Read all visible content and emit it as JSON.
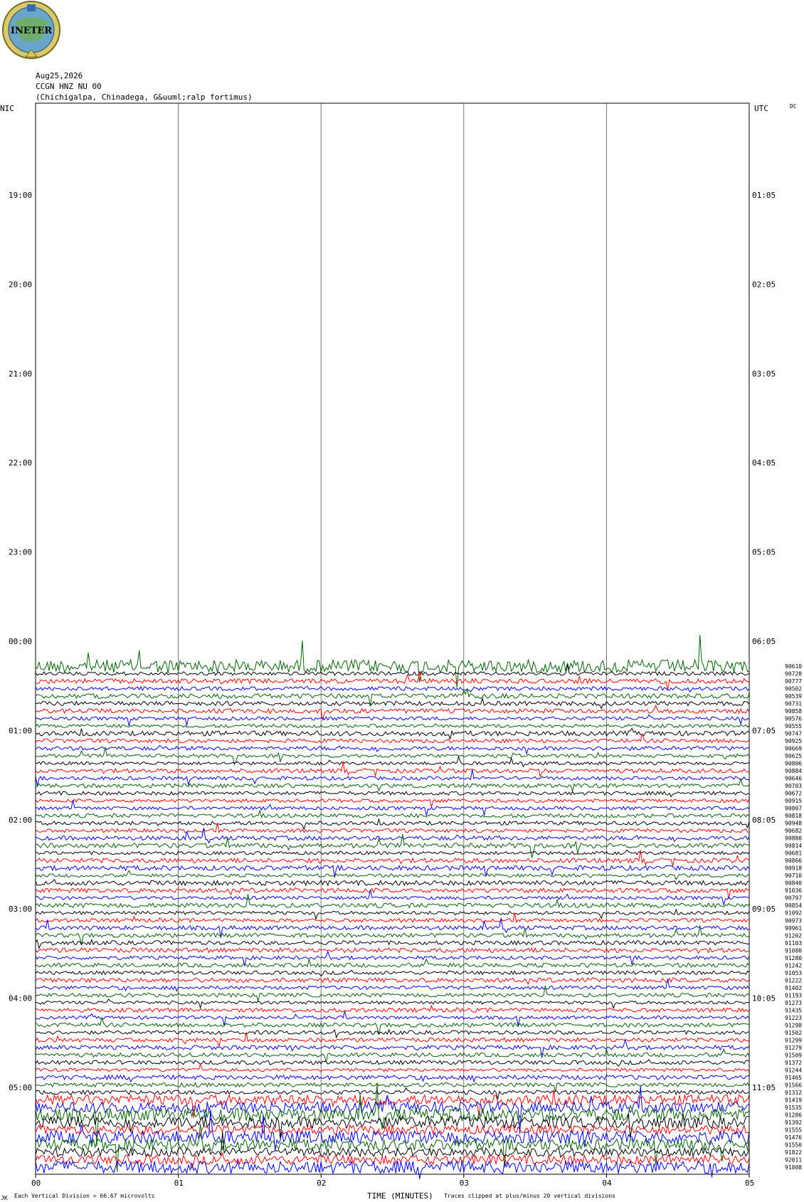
{
  "header": {
    "logo_text": "INETER",
    "date": "Aug25,2026",
    "station": "CCGN HNZ NU 00",
    "location": "(Chichigalpa, Chinadega, G&uuml;ralp fortimus)"
  },
  "chart_data": {
    "type": "line",
    "left_axis_label": "NIC",
    "right_axis_label": "UTC",
    "dc_label": "DC",
    "left_hour_labels": [
      "19:00",
      "20:00",
      "21:00",
      "22:00",
      "23:00",
      "00:00",
      "01:00",
      "02:00",
      "03:00",
      "04:00",
      "05:00"
    ],
    "right_hour_labels": [
      "01:05",
      "02:05",
      "03:05",
      "04:05",
      "05:05",
      "06:05",
      "07:05",
      "08:05",
      "09:05",
      "10:05",
      "11:05"
    ],
    "x_tick_labels": [
      "00",
      "01",
      "02",
      "03",
      "04",
      "05"
    ],
    "x_axis_title": "TIME (MINUTES)",
    "xlim": [
      0,
      5
    ],
    "footer_left": "Each Vertical Division =   66.67 microvolts",
    "footer_right": "Traces clipped at plus/minus 20 vertical divisions",
    "footer_corner": "JK",
    "trace_colors": [
      "#000000",
      "#ff0000",
      "#0000ff",
      "#006400"
    ],
    "traces": [
      {
        "count": "90610",
        "color": "#006400"
      },
      {
        "count": "90728",
        "color": "#000000"
      },
      {
        "count": "90777",
        "color": "#ff0000"
      },
      {
        "count": "90502",
        "color": "#0000ff"
      },
      {
        "count": "90539",
        "color": "#006400"
      },
      {
        "count": "90731",
        "color": "#000000"
      },
      {
        "count": "90858",
        "color": "#ff0000"
      },
      {
        "count": "90576",
        "color": "#0000ff"
      },
      {
        "count": "90555",
        "color": "#006400"
      },
      {
        "count": "90747",
        "color": "#000000"
      },
      {
        "count": "90925",
        "color": "#ff0000"
      },
      {
        "count": "90669",
        "color": "#0000ff"
      },
      {
        "count": "90625",
        "color": "#006400"
      },
      {
        "count": "90806",
        "color": "#000000"
      },
      {
        "count": "90884",
        "color": "#ff0000"
      },
      {
        "count": "90646",
        "color": "#0000ff"
      },
      {
        "count": "90703",
        "color": "#006400"
      },
      {
        "count": "90672",
        "color": "#000000"
      },
      {
        "count": "90915",
        "color": "#ff0000"
      },
      {
        "count": "90807",
        "color": "#0000ff"
      },
      {
        "count": "90818",
        "color": "#006400"
      },
      {
        "count": "90948",
        "color": "#000000"
      },
      {
        "count": "90682",
        "color": "#ff0000"
      },
      {
        "count": "90880",
        "color": "#0000ff"
      },
      {
        "count": "90814",
        "color": "#006400"
      },
      {
        "count": "90681",
        "color": "#000000"
      },
      {
        "count": "90866",
        "color": "#ff0000"
      },
      {
        "count": "90918",
        "color": "#0000ff"
      },
      {
        "count": "90710",
        "color": "#006400"
      },
      {
        "count": "90840",
        "color": "#000000"
      },
      {
        "count": "91036",
        "color": "#ff0000"
      },
      {
        "count": "90797",
        "color": "#0000ff"
      },
      {
        "count": "90854",
        "color": "#006400"
      },
      {
        "count": "91092",
        "color": "#000000"
      },
      {
        "count": "90973",
        "color": "#ff0000"
      },
      {
        "count": "90961",
        "color": "#0000ff"
      },
      {
        "count": "91202",
        "color": "#006400"
      },
      {
        "count": "91103",
        "color": "#000000"
      },
      {
        "count": "91080",
        "color": "#ff0000"
      },
      {
        "count": "91280",
        "color": "#0000ff"
      },
      {
        "count": "91242",
        "color": "#006400"
      },
      {
        "count": "91053",
        "color": "#000000"
      },
      {
        "count": "91222",
        "color": "#ff0000"
      },
      {
        "count": "91402",
        "color": "#0000ff"
      },
      {
        "count": "91193",
        "color": "#006400"
      },
      {
        "count": "91273",
        "color": "#000000"
      },
      {
        "count": "91435",
        "color": "#ff0000"
      },
      {
        "count": "91223",
        "color": "#0000ff"
      },
      {
        "count": "91298",
        "color": "#006400"
      },
      {
        "count": "91502",
        "color": "#000000"
      },
      {
        "count": "91299",
        "color": "#ff0000"
      },
      {
        "count": "91279",
        "color": "#0000ff"
      },
      {
        "count": "91509",
        "color": "#006400"
      },
      {
        "count": "91372",
        "color": "#000000"
      },
      {
        "count": "91244",
        "color": "#ff0000"
      },
      {
        "count": "91465",
        "color": "#0000ff"
      },
      {
        "count": "91566",
        "color": "#006400"
      },
      {
        "count": "91312",
        "color": "#000000"
      },
      {
        "count": "91419",
        "color": "#ff0000"
      },
      {
        "count": "91535",
        "color": "#0000ff"
      },
      {
        "count": "91286",
        "color": "#006400"
      },
      {
        "count": "91392",
        "color": "#000000"
      },
      {
        "count": "91555",
        "color": "#ff0000"
      },
      {
        "count": "91476",
        "color": "#0000ff"
      },
      {
        "count": "91550",
        "color": "#006400"
      },
      {
        "count": "91822",
        "color": "#000000"
      },
      {
        "count": "92011",
        "color": "#ff0000"
      },
      {
        "count": "91808",
        "color": "#0000ff"
      }
    ]
  }
}
